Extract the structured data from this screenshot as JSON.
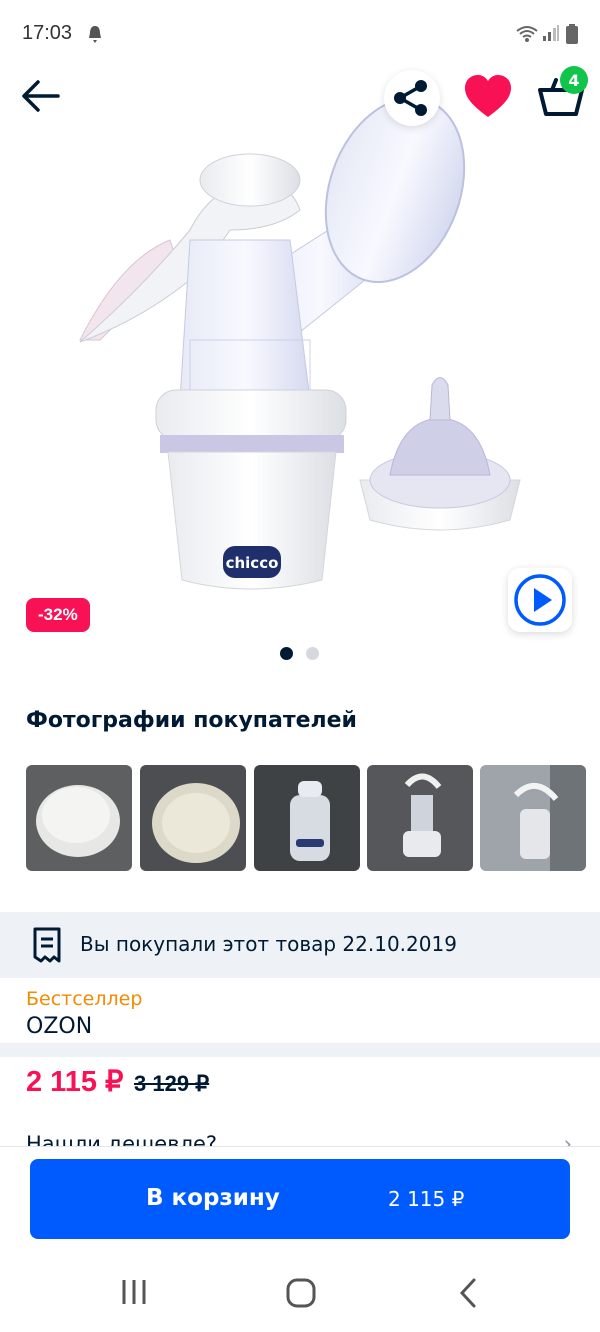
{
  "status_bar": {
    "time": "17:03"
  },
  "header": {
    "cart_count": "4"
  },
  "product": {
    "discount_badge": "-32%",
    "brand_on_image": "chicco",
    "active_slide": 0,
    "slide_count": 2
  },
  "customer_photos": {
    "title": "Фотографии покупателей"
  },
  "purchase_info": {
    "text": "Вы покупали этот товар 22.10.2019"
  },
  "seller": {
    "badge": "Бестселлер",
    "name": "OZON"
  },
  "pricing": {
    "price": "2 115 ₽",
    "old_price": "3 129 ₽"
  },
  "cheaper_link": {
    "label": "Нашли дешевле?"
  },
  "cart_button": {
    "label": "В корзину",
    "price": "2 115 ₽"
  },
  "colors": {
    "accent": "#005bff",
    "price": "#f91155",
    "bestseller": "#f28b00",
    "badge_green": "#10c44c"
  },
  "icons": [
    "back-arrow-icon",
    "share-icon",
    "heart-icon",
    "cart-icon",
    "play-icon",
    "receipt-icon",
    "chevron-right-icon",
    "recent-apps-icon",
    "home-icon",
    "back-icon"
  ]
}
